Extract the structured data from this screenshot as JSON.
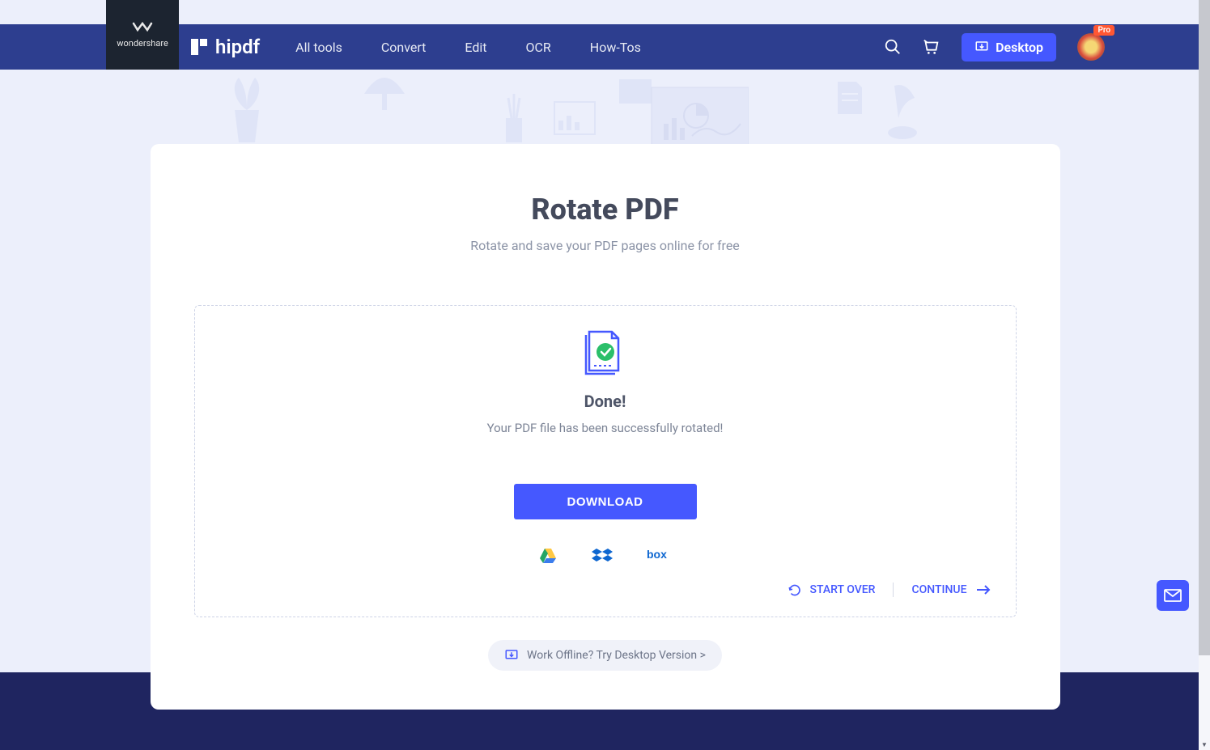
{
  "brand": {
    "wondershare": "wondershare",
    "name": "hipdf"
  },
  "nav": {
    "items": [
      "All tools",
      "Convert",
      "Edit",
      "OCR",
      "How-Tos"
    ],
    "desktop": "Desktop",
    "proBadge": "Pro"
  },
  "page": {
    "title": "Rotate PDF",
    "subtitle": "Rotate and save your PDF pages online for free"
  },
  "result": {
    "done": "Done!",
    "message": "Your PDF file has been successfully rotated!",
    "download": "DOWNLOAD"
  },
  "cloud": {
    "drive": "google-drive",
    "dropbox": "dropbox",
    "box": "box"
  },
  "actions": {
    "startOver": "START OVER",
    "continue": "CONTINUE"
  },
  "offline": "Work Offline? Try Desktop Version >",
  "colors": {
    "accent": "#4558ff",
    "navbg": "#2d3e8f"
  }
}
